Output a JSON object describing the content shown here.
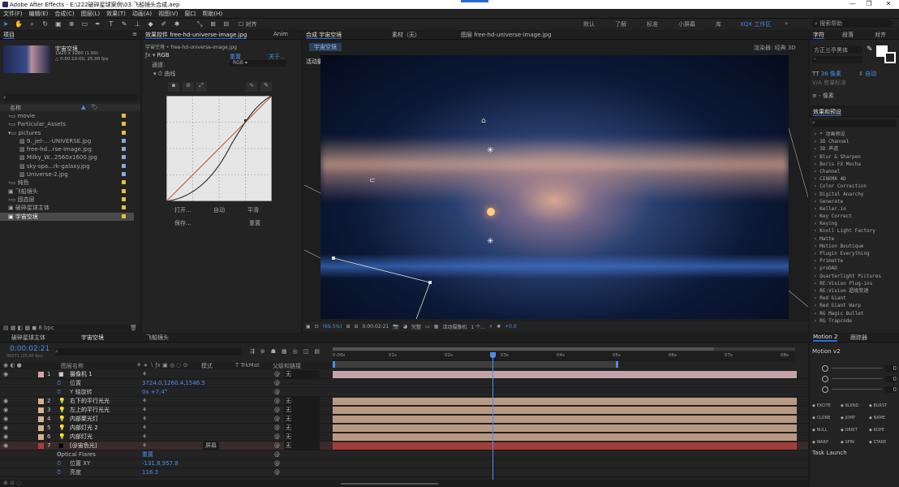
{
  "app": {
    "title": "Adobe After Effects - E:\\222破碎星球案例\\03.飞船镜头合成.aep",
    "win_min": "—",
    "win_max": "❐",
    "win_close": "✕"
  },
  "menu": [
    "文件(F)",
    "编辑(E)",
    "合成(C)",
    "图层(L)",
    "效果(T)",
    "动画(A)",
    "视图(V)",
    "窗口",
    "帮助(H)"
  ],
  "toolbar": {
    "snap_label": "对齐"
  },
  "workspaces": [
    {
      "label": "默认",
      "active": false
    },
    {
      "label": "了解",
      "active": false
    },
    {
      "label": "标准",
      "active": false
    },
    {
      "label": "小屏幕",
      "active": false
    },
    {
      "label": "库",
      "active": false
    },
    {
      "label": "XQX 工作区",
      "active": true
    }
  ],
  "project": {
    "tab": "项目",
    "comp_name": "宇宙空境",
    "comp_info1": "1920 x 1080 (1.00)",
    "comp_info2": "△ 0:00:10:00, 25.00 fps",
    "col_name": "名称",
    "search_placeholder": "",
    "items": [
      {
        "label": "movie",
        "color": "#e0c040",
        "kind": "folder"
      },
      {
        "label": "Particular_Assets",
        "color": "#e0c040",
        "kind": "folder"
      },
      {
        "label": "pictures",
        "color": "#e0c040",
        "kind": "folder-open"
      },
      {
        "label": "9._jet-...-UNIVERSE.jpg",
        "color": "#8fa6d8",
        "kind": "file"
      },
      {
        "label": "free-hd...rse-image.jpg",
        "color": "#8fa6d8",
        "kind": "file"
      },
      {
        "label": "Milky_W...2560x1600.jpg",
        "color": "#8fa6d8",
        "kind": "file"
      },
      {
        "label": "sky-spa...rk-galaxy.jpg",
        "color": "#8fa6d8",
        "kind": "file"
      },
      {
        "label": "Universe-2.jpg",
        "color": "#8fa6d8",
        "kind": "file"
      },
      {
        "label": "纯色",
        "color": "#e0c040",
        "kind": "folder"
      },
      {
        "label": "飞船镜头",
        "color": "#e0c040",
        "kind": "comp"
      },
      {
        "label": "固态层",
        "color": "#e0c040",
        "kind": "folder"
      },
      {
        "label": "破碎星球主体",
        "color": "#e0c040",
        "kind": "comp"
      },
      {
        "label": "宇宙空境",
        "color": "#e0c040",
        "kind": "comp",
        "selected": true
      }
    ],
    "bpc": "8 bpc"
  },
  "effects_panel": {
    "tab": "效果控件 free-hd-universe-image.jpg",
    "tab2": "Anim",
    "path": "宇宙空境 • free-hd-universe-image.jpg",
    "fx_name": "RGB",
    "fx_reset": "重置",
    "fx_about": "关于...",
    "curve_name": "曲线",
    "channel_label": "通道:",
    "channel_value": "RGB",
    "btn_open": "打开...",
    "btn_auto": "自动",
    "btn_smooth": "平滑",
    "btn_save": "保存...",
    "btn_reset": "重置"
  },
  "composition": {
    "tab": "合成 宇宙空境",
    "footage_tab": "素材（无）",
    "layer_tab": "图层 free-hd-universe-image.jpg",
    "sub_tab": "宇宙空境",
    "renderer_label": "渲染器:",
    "renderer_value": "经典 3D",
    "camera_label": "活动摄像机",
    "zoom": "(69.5%)",
    "timecode": "0:00:02:21",
    "quality": "完整",
    "view": "活动摄像机",
    "views": "1 个...",
    "exposure": "+0.0"
  },
  "character": {
    "tab": "字符",
    "tab2": "段落",
    "tab3": "对齐",
    "font": "方正兰亭黑体",
    "style": "-",
    "size": "36 像素",
    "leading": "自动",
    "tracking_unit": "像素",
    "kerning_label": "度量标准"
  },
  "effects_presets": {
    "tab": "效果和预设",
    "items": [
      "* 动画预设",
      "3D Channel",
      "3D 声道",
      "Blur & Sharpen",
      "Boris FX Mocha",
      "Channel",
      "CINEMA 4D",
      "Color Correction",
      "Digital Anarchy",
      "Generate",
      "Keller.io",
      "Key Correct",
      "Keying",
      "Knoll Light Factory",
      "Matte",
      "Motion Boutique",
      "Plugin Everything",
      "Primatte",
      "proDAD",
      "Quarterlight Pictures",
      "RE:Vision Plug-ins",
      "RE:Vision 超级变速",
      "Red Giant",
      "Red Giant Warp",
      "RG Magic Bullet",
      "RG Trapcode"
    ]
  },
  "timeline": {
    "tabs": [
      "破碎星球主体",
      "宇宙空境",
      "飞船镜头"
    ],
    "active_tab": 1,
    "timecode": "0:00:02:21",
    "frames": "00071 (25.00 fps)",
    "col_layer": "图层名称",
    "col_mode": "模式",
    "col_trkmat": "T TrkMat",
    "col_parent": "父级和链接",
    "ruler": [
      "0:00s",
      "01s",
      "02s",
      "03s",
      "04s",
      "05s",
      "06s",
      "07s",
      "08s"
    ],
    "playhead_fraction": 0.286,
    "layers": [
      {
        "num": "1",
        "name": "摄像机 1",
        "color": "#d8a0a8",
        "kind": "camera",
        "parent": "无",
        "mode": "",
        "bar": "#c1a3a9"
      },
      {
        "num": "",
        "name": "位置",
        "kind": "prop",
        "value": "3724.0,1260.4,1546.5"
      },
      {
        "num": "",
        "name": "Y 轴旋转",
        "kind": "prop",
        "value": "0x +7.4°"
      },
      {
        "num": "2",
        "name": "右下的平行光光",
        "color": "#d8b090",
        "kind": "light",
        "parent": "无",
        "bar": "#b89a84"
      },
      {
        "num": "3",
        "name": "左上的平行光光",
        "color": "#d8b090",
        "kind": "light",
        "parent": "无",
        "bar": "#b89a84"
      },
      {
        "num": "4",
        "name": "内部聚光灯",
        "color": "#d8b090",
        "kind": "light",
        "parent": "无",
        "bar": "#b89a84"
      },
      {
        "num": "5",
        "name": "内部灯光 2",
        "color": "#d8b090",
        "kind": "light",
        "parent": "无",
        "bar": "#b89a84"
      },
      {
        "num": "6",
        "name": "内部灯光",
        "color": "#d8b090",
        "kind": "light",
        "parent": "无",
        "bar": "#b89a84"
      },
      {
        "num": "7",
        "name": "[@宙色光]",
        "color": "#b03a3a",
        "kind": "solid",
        "parent": "无",
        "mode": "屏幕",
        "bar": "#a13c3c"
      },
      {
        "num": "",
        "name": "Optical Flares",
        "kind": "group",
        "value": "重置"
      },
      {
        "num": "",
        "name": "位置 XY",
        "kind": "prop",
        "value": "-131.8,957.8"
      },
      {
        "num": "",
        "name": "亮度",
        "kind": "prop",
        "value": "116.3"
      }
    ]
  },
  "motion": {
    "tab": "Motion 2",
    "tab2": "跟踪器",
    "version": "Motion v2",
    "val": "0",
    "buttons": [
      "EXCITE",
      "BLEND",
      "BURST",
      "CLONE",
      "JUMP",
      "NAME",
      "NULL",
      "ORBIT",
      "ROPE",
      "WARP",
      "SPIN",
      "STARE"
    ],
    "task": "Task Launch"
  }
}
